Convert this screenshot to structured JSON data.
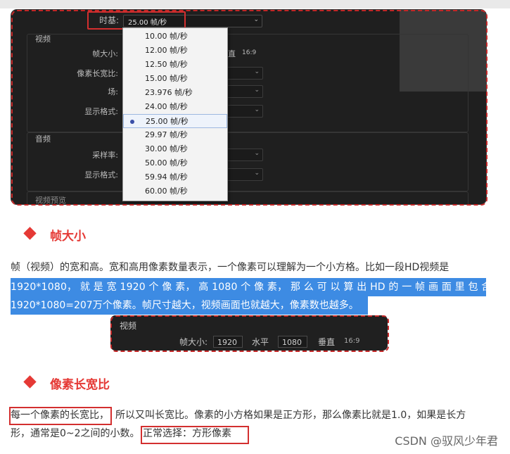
{
  "panel1": {
    "timebase_label": "时基:",
    "timebase_value": "25.00  帧/秒",
    "video_section": "视频",
    "frame_size_label": "帧大小:",
    "frame_size_tail": "直",
    "frame_size_ratio": "16:9",
    "pixel_aspect_label": "像素长宽比:",
    "field_label": "场:",
    "display_format_label": "显示格式:",
    "audio_section": "音频",
    "sample_rate_label": "采样率:",
    "audio_display_format_label": "显示格式:",
    "bottom_section": "视频预览",
    "dropdown_options": [
      "10.00  帧/秒",
      "12.00  帧/秒",
      "12.50  帧/秒",
      "15.00  帧/秒",
      "23.976  帧/秒",
      "24.00  帧/秒",
      "25.00  帧/秒",
      "29.97  帧/秒",
      "30.00  帧/秒",
      "50.00  帧/秒",
      "59.94  帧/秒",
      "60.00  帧/秒"
    ],
    "selected_index": 6
  },
  "section1": {
    "title": "帧大小",
    "line1": "帧（视频）的宽和高。宽和高用像素数量表示，一个像素可以理解为一个小方格。比如一段HD视频是",
    "line2": "1920*1080， 就 是 宽 1920 个 像 素， 高 1080 个 像 素， 那 么 可 以 算 出 HD 的 一 帧 画 面 里 包 含",
    "line3": "1920*1080=207万个像素。帧尺寸越大，视频画面也就越大，像素数也越多。"
  },
  "panel2": {
    "section": "视频",
    "frame_size_label": "帧大小:",
    "width_value": "1920",
    "horizontal_label": "水平",
    "height_value": "1080",
    "vertical_label": "垂直",
    "ratio": "16:9"
  },
  "section2": {
    "title": "像素长宽比",
    "line1_boxed": "每一个像素的长宽比，",
    "line1_rest": "所以又叫长宽比。像素的小方格如果是正方形，那么像素比就是1.0，如果是长方",
    "line2_start": "形，通常是0~2之间的小数。",
    "line2_boxed": "正常选择：方形像素"
  },
  "watermark": "CSDN @驭风少年君",
  "colors": {
    "accent_red": "#e53935",
    "highlight_blue": "#3d8be3",
    "panel_dark": "#1f1f1f"
  }
}
